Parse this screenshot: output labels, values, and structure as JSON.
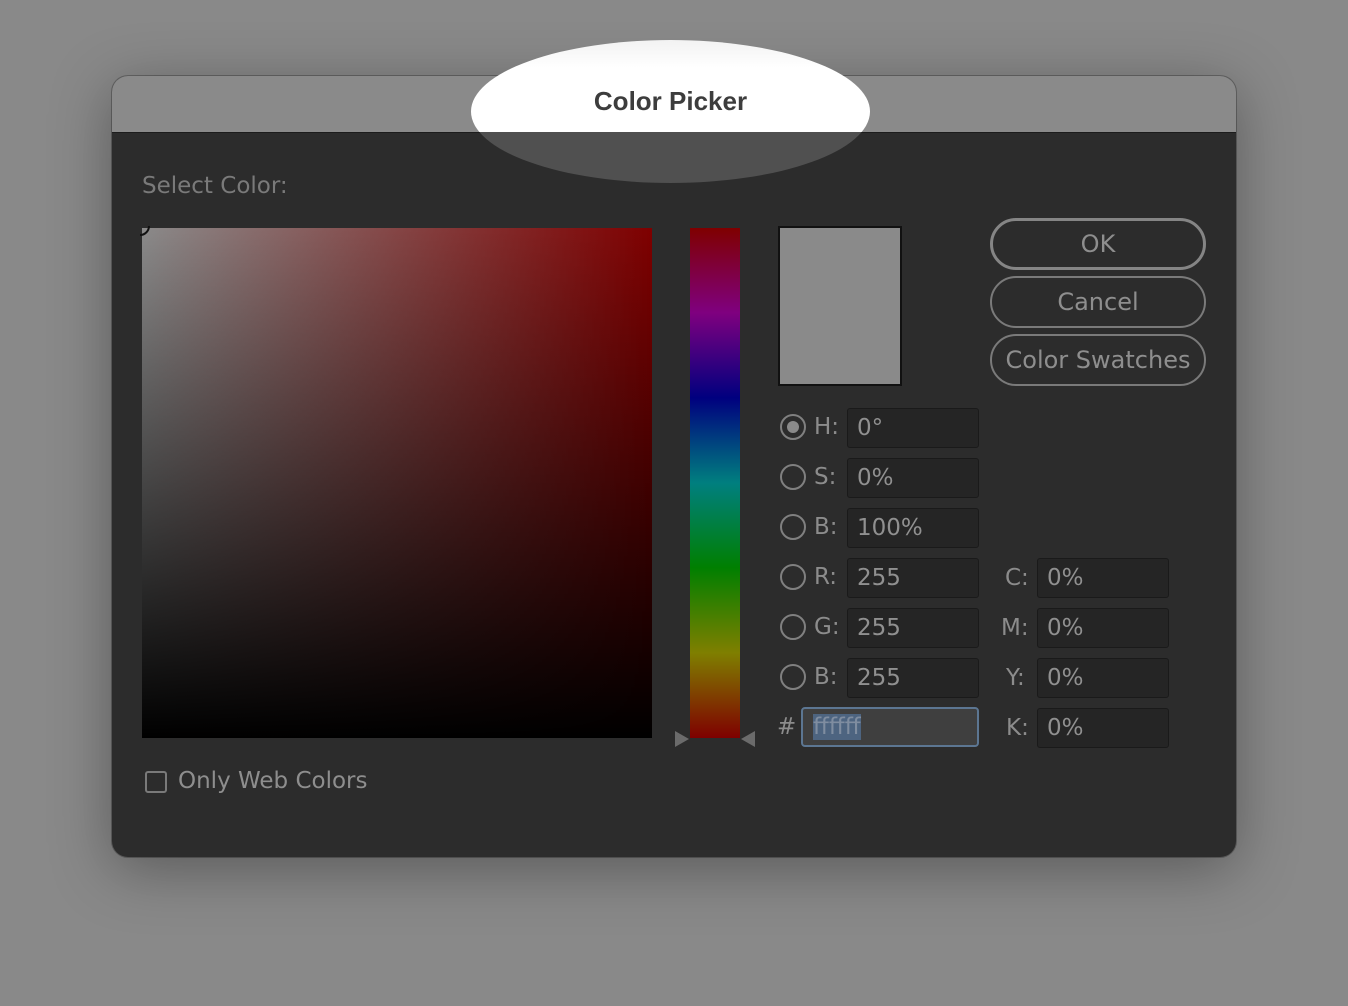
{
  "dialog": {
    "title": "Color Picker",
    "select_label": "Select Color:"
  },
  "buttons": {
    "ok": "OK",
    "cancel": "Cancel",
    "swatches": "Color Swatches"
  },
  "hsb": {
    "h_label": "H:",
    "h_value": "0°",
    "s_label": "S:",
    "s_value": "0%",
    "b_label": "B:",
    "b_value": "100%",
    "selected": "H"
  },
  "rgb": {
    "r_label": "R:",
    "r_value": "255",
    "g_label": "G:",
    "g_value": "255",
    "b_label": "B:",
    "b_value": "255"
  },
  "cmyk": {
    "c_label": "C:",
    "c_value": "0%",
    "m_label": "M:",
    "m_value": "0%",
    "y_label": "Y:",
    "y_value": "0%",
    "k_label": "K:",
    "k_value": "0%"
  },
  "hex": {
    "label": "#",
    "value": "ffffff"
  },
  "options": {
    "only_web_colors": "Only Web Colors",
    "only_web_colors_checked": false
  },
  "colors": {
    "dialog_bg": "#2c2c2c",
    "titlebar_bg": "#8a8a8a",
    "preview_color": "#8a8a8a",
    "hue_top": "#7f0000",
    "hex_border": "#5c7692"
  },
  "icons": {
    "hue_slider_left": "triangle-right-icon",
    "hue_slider_right": "triangle-left-icon",
    "field_marker": "circle-marker-icon"
  }
}
